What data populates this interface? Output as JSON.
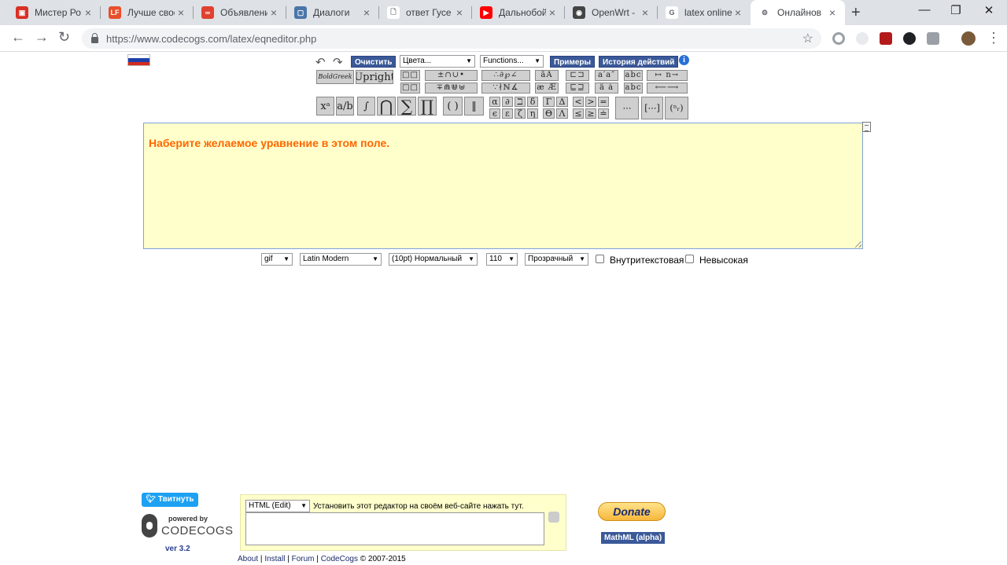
{
  "browser": {
    "tabs": [
      {
        "title": "Мистер Ро",
        "favicon_color": "#d93025",
        "favicon_glyph": "▣"
      },
      {
        "title": "Лучше свое",
        "favicon_color": "#e94e2b",
        "favicon_glyph": "LF"
      },
      {
        "title": "Объявлени",
        "favicon_color": "#e0412f",
        "favicon_glyph": "∞"
      },
      {
        "title": "Диалоги",
        "favicon_color": "#4a76a8",
        "favicon_glyph": "▢"
      },
      {
        "title": "ответ Гусе",
        "favicon_color": "#ffffff",
        "favicon_glyph": "🗋"
      },
      {
        "title": "Дальнобой",
        "favicon_color": "#ff0000",
        "favicon_glyph": "▶"
      },
      {
        "title": "OpenWrt -",
        "favicon_color": "#444444",
        "favicon_glyph": "◉"
      },
      {
        "title": "latex online",
        "favicon_color": "#ffffff",
        "favicon_glyph": "G"
      },
      {
        "title": "Онлайнов",
        "favicon_color": "#ffffff",
        "favicon_glyph": "⚙"
      }
    ],
    "close_glyph": "×",
    "new_tab_glyph": "+",
    "window_controls": {
      "minimize": "—",
      "maximize": "❐",
      "close": "✕"
    },
    "nav": {
      "back": "←",
      "forward": "→",
      "reload": "↻"
    },
    "url": "https://www.codecogs.com/latex/eqneditor.php",
    "star": "☆"
  },
  "toolbar": {
    "clear_label": "Очистить",
    "colors_label": "Цвета...",
    "functions_label": "Functions...",
    "examples_label": "Примеры",
    "history_label": "История действий",
    "info_glyph": "i",
    "undo_glyph": "↶",
    "redo_glyph": "↷",
    "boldgreek_label": "BoldGreek",
    "upright_label": "Upright",
    "row1_groups": [
      "□□",
      "±∩∪•",
      "∴∂℘∠",
      "āȦ",
      "⊏⊐",
      "a′a″",
      "abc",
      "↦ n→"
    ],
    "row2_groups": [
      "□□",
      "∓⋒⋓⊎",
      "∵∤ℕ∡",
      "æ Æ",
      "⊑⊒",
      "ä ȧ",
      "abc",
      "⟵⟶"
    ],
    "big_buttons": [
      "xᵃ",
      "a/b",
      "∫",
      "⋂",
      "∑",
      "∏",
      "( )",
      "‖"
    ],
    "greek_lower": [
      "α",
      "∂",
      "ℶ",
      "δ",
      "ϵ",
      "ε",
      "ζ",
      "η"
    ],
    "greek_upper": [
      "Γ",
      "Δ",
      "Θ",
      "Λ"
    ],
    "relations_top": [
      "<",
      ">",
      "="
    ],
    "relations_bottom": [
      "≤",
      "≥",
      "≐"
    ],
    "matrix_glyphs": [
      "⋯",
      "[⋯]",
      "(ⁿᵣ)"
    ]
  },
  "editor": {
    "placeholder": "Наберите желаемое уравнение в этом поле."
  },
  "options": {
    "format": "gif",
    "font": "Latin Modern",
    "size": "(10pt) Нормальный",
    "dpi": "110",
    "background": "Прозрачный",
    "inline_label": "Внутритекстовая",
    "compressed_label": "Невысокая",
    "dropdown_arrow": "▼"
  },
  "footer": {
    "tweet_label": "Твитнуть",
    "powered_by": "powered by",
    "codecogs_logo": "CODECOGS",
    "version": "ver 3.2",
    "install_mode": "HTML (Edit)",
    "install_label": "Установить этот редактор на своём веб-сайте нажать тут.",
    "donate_label": "Donate",
    "mathml_label": "MathML (alpha)",
    "links": [
      "About",
      "Install",
      "Forum",
      "CodeCogs"
    ],
    "separator": "|",
    "copyright": "© 2007-2015"
  },
  "colors": {
    "accent_blue": "#3b5998",
    "editor_bg": "#ffffcc",
    "placeholder_orange": "#ff6600"
  }
}
